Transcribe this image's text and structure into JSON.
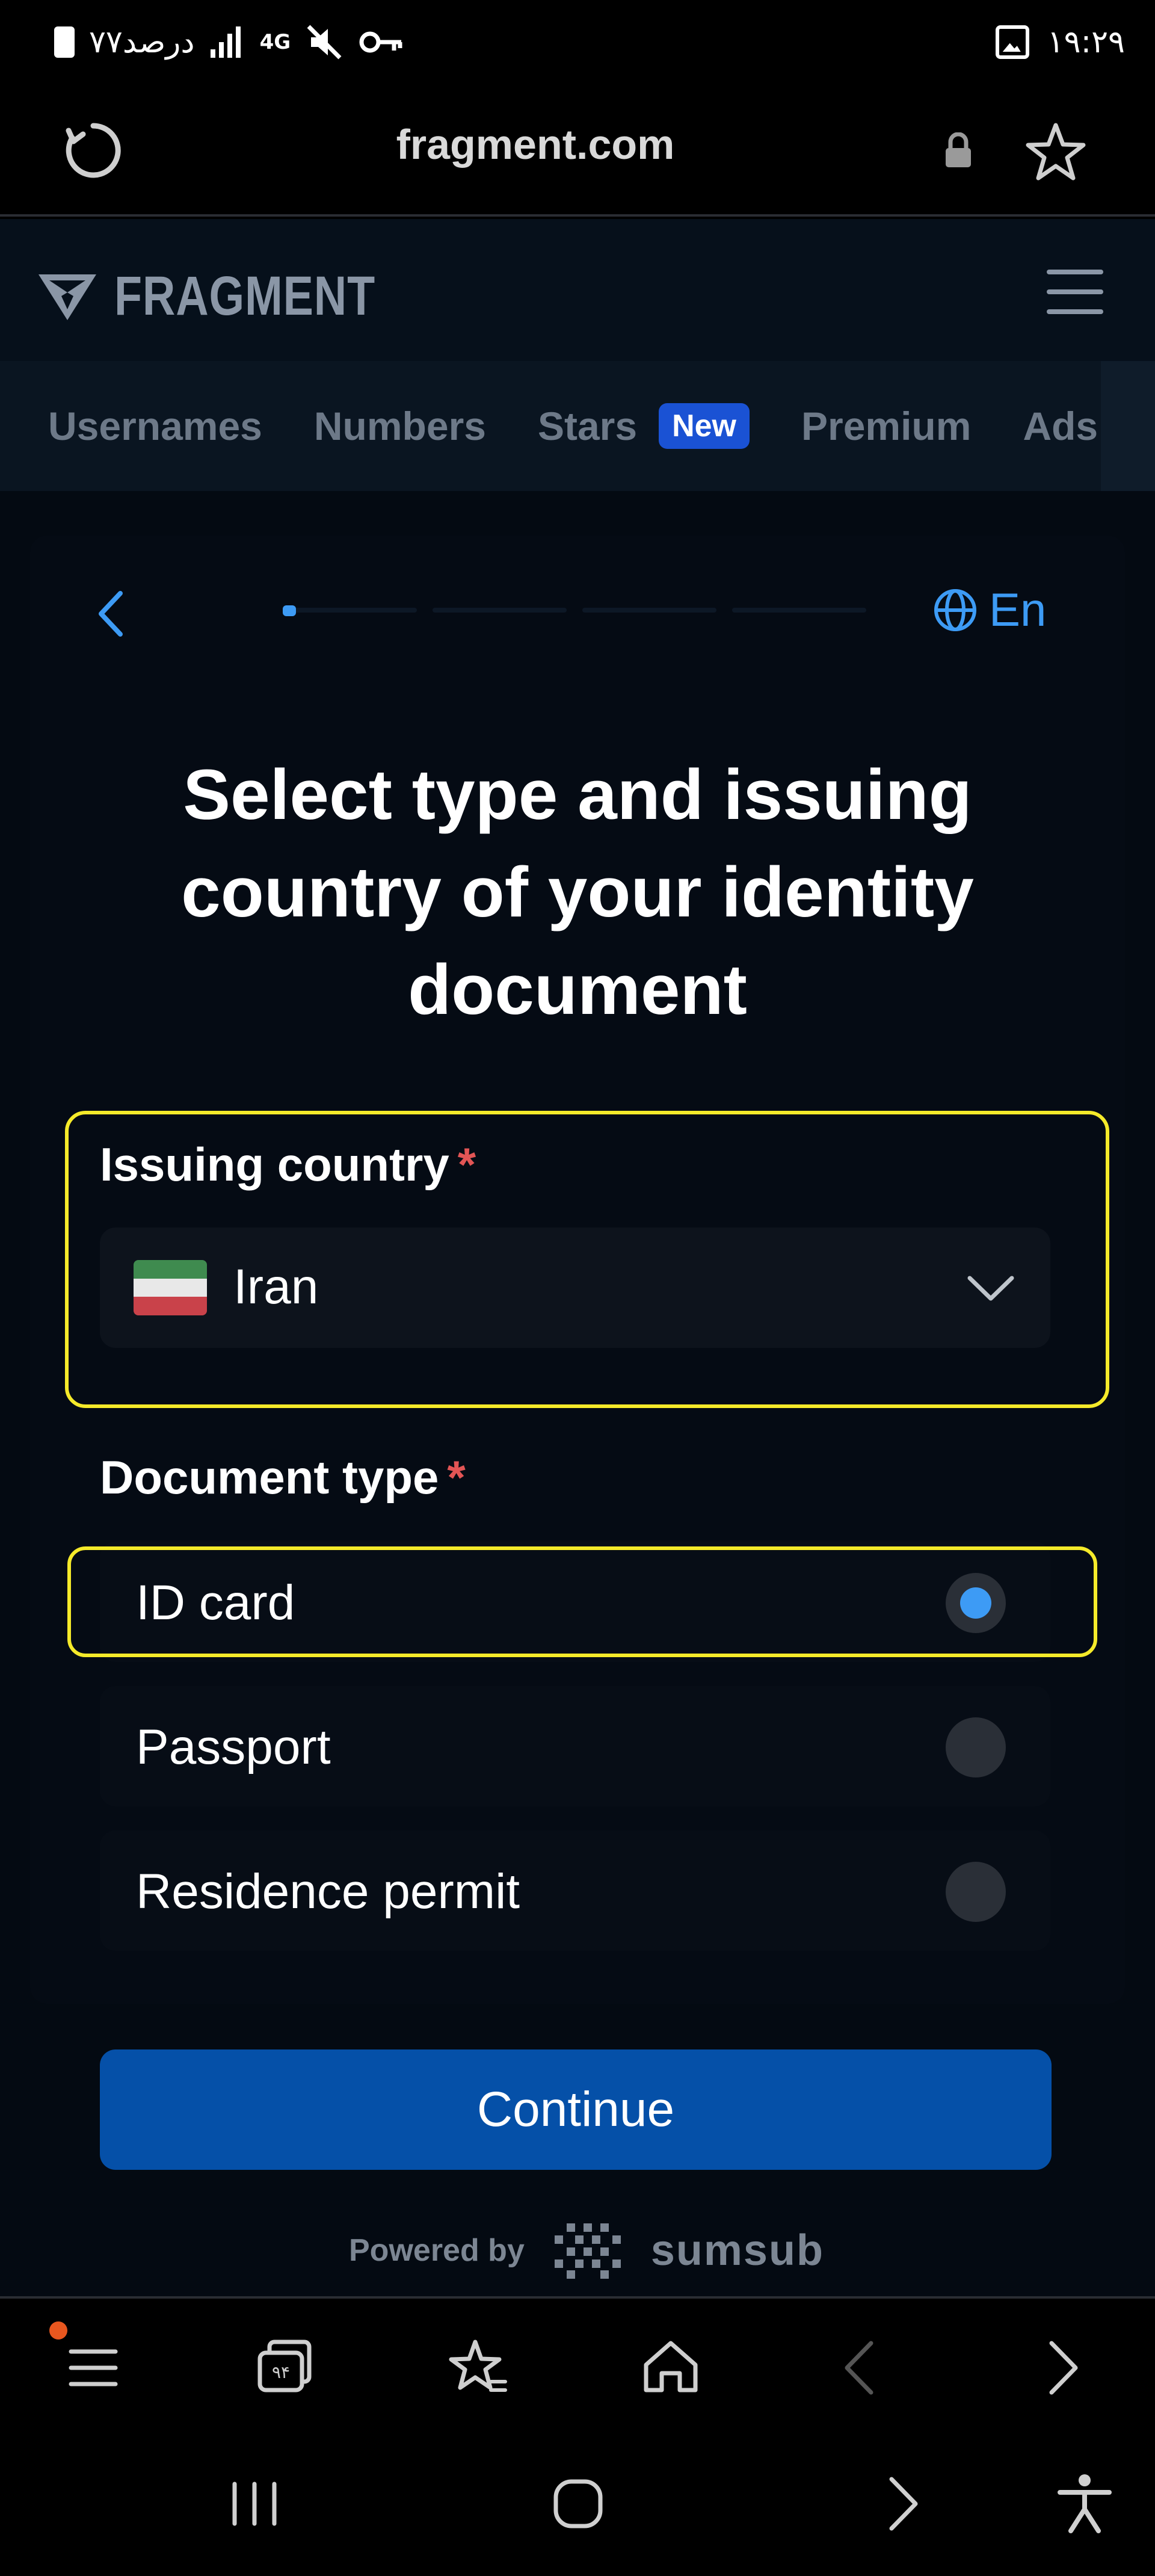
{
  "status_bar": {
    "left_text": "۷۷درصد",
    "network": "4G",
    "time": "۱۹:۲۹"
  },
  "browser": {
    "url": "fragment.com"
  },
  "site": {
    "logo_text": "FRAGMENT",
    "tabs": [
      {
        "label": "Usernames"
      },
      {
        "label": "Numbers"
      },
      {
        "label": "Stars",
        "badge": "New"
      },
      {
        "label": "Premium"
      },
      {
        "label": "Ads"
      }
    ]
  },
  "verification": {
    "language": "En",
    "progress_step": 1,
    "title": "Select type and issuing country of your identity document",
    "country_label": "Issuing country",
    "required_mark": "*",
    "country_value": "Iran",
    "document_label": "Document type",
    "documents": [
      {
        "label": "ID card",
        "checked": true
      },
      {
        "label": "Passport",
        "checked": false
      },
      {
        "label": "Residence permit",
        "checked": false
      }
    ],
    "continue_label": "Continue",
    "powered_by": "Powered by",
    "provider": "sumsub"
  },
  "colors": {
    "accent": "#3d9bf5",
    "button": "#0550a8",
    "highlight": "#f5ea2a",
    "required": "#e25555",
    "notification": "#e8571f"
  },
  "bottom_bar": {
    "tab_count": "۹۴"
  }
}
